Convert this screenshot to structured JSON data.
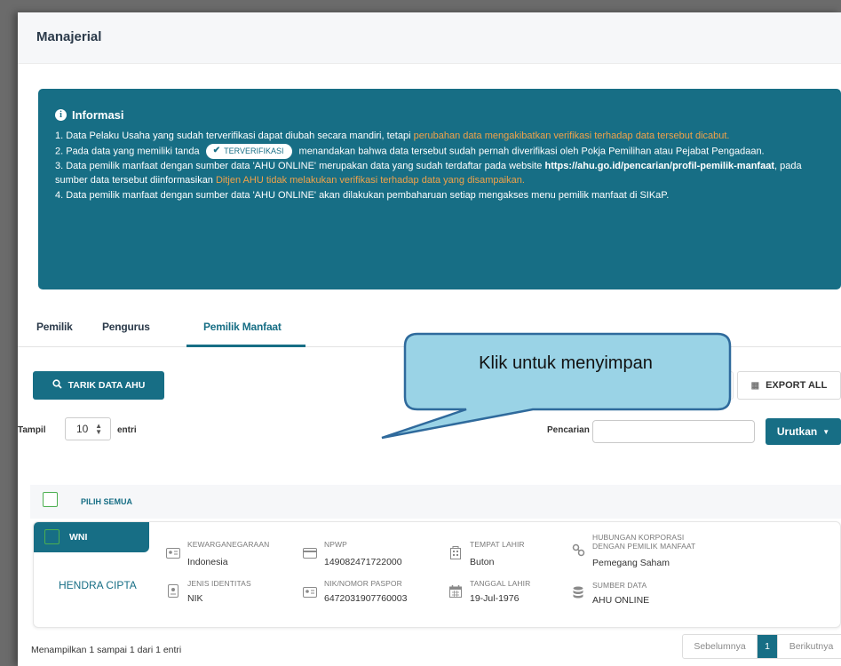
{
  "header": {
    "title": "Manajerial"
  },
  "info": {
    "heading": "Informasi",
    "item1_a": "1. Data Pelaku Usaha yang sudah terverifikasi dapat diubah secara mandiri, tetapi ",
    "item1_b": "perubahan data mengakibatkan verifikasi terhadap data tersebut dicabut.",
    "item2_a": "2. Pada data yang memiliki tanda",
    "item2_badge": "TERVERIFIKASI",
    "item2_b": "menandakan bahwa data tersebut sudah pernah diverifikasi oleh Pokja Pemilihan atau Pejabat Pengadaan.",
    "item3_a": "3. Data pemilik manfaat dengan sumber data 'AHU ONLINE' merupakan data yang sudah terdaftar pada website ",
    "item3_link": "https://ahu.go.id/pencarian/profil-pemilik-manfaat",
    "item3_b": ", pada sumber data tersebut diinformasikan ",
    "item3_c": "Ditjen AHU tidak melakukan verifikasi terhadap data yang disampaikan.",
    "item4": "4. Data pemilik manfaat dengan sumber data 'AHU ONLINE' akan dilakukan pembaharuan setiap mengakses menu pemilik manfaat di SIKaP."
  },
  "tabs": [
    {
      "label": "Pemilik"
    },
    {
      "label": "Pengurus"
    },
    {
      "label": "Pemilik Manfaat"
    }
  ],
  "toolbar": {
    "tarik_label": "TARIK DATA AHU",
    "export_label": "EXPORT ALL"
  },
  "list_controls": {
    "tampil_label": "Tampil",
    "page_size": "10",
    "entri_label": "entri",
    "search_label": "Pencarian",
    "search_value": "",
    "sort_label": "Urutkan"
  },
  "select_all_label": "PILIH SEMUA",
  "records": [
    {
      "tag": "WNI",
      "name": "HENDRA CIPTA",
      "kewarganegaraan_label": "KEWARGANEGARAAN",
      "kewarganegaraan": "Indonesia",
      "jenis_identitas_label": "JENIS IDENTITAS",
      "jenis_identitas": "NIK",
      "npwp_label": "NPWP",
      "npwp": "149082471722000",
      "nik_label": "NIK/NOMOR PASPOR",
      "nik": "6472031907760003",
      "tempat_lahir_label": "TEMPAT LAHIR",
      "tempat_lahir": "Buton",
      "tanggal_lahir_label": "TANGGAL LAHIR",
      "tanggal_lahir": "19-Jul-1976",
      "hubungan_label_1": "HUBUNGAN KORPORASI",
      "hubungan_label_2": "DENGAN PEMILIK MANFAAT",
      "hubungan": "Pemegang Saham",
      "sumber_label": "SUMBER DATA",
      "sumber": "AHU ONLINE"
    }
  ],
  "footer": {
    "summary": "Menampilkan 1 sampai 1 dari 1 entri",
    "prev_label": "Sebelumnya",
    "current_page": "1",
    "next_label": "Berikutnya"
  },
  "callout": {
    "text": "Klik untuk menyimpan"
  },
  "colors": {
    "primary": "#176e85",
    "warning": "#f0a24a",
    "checkbox_border": "#4caf50"
  }
}
